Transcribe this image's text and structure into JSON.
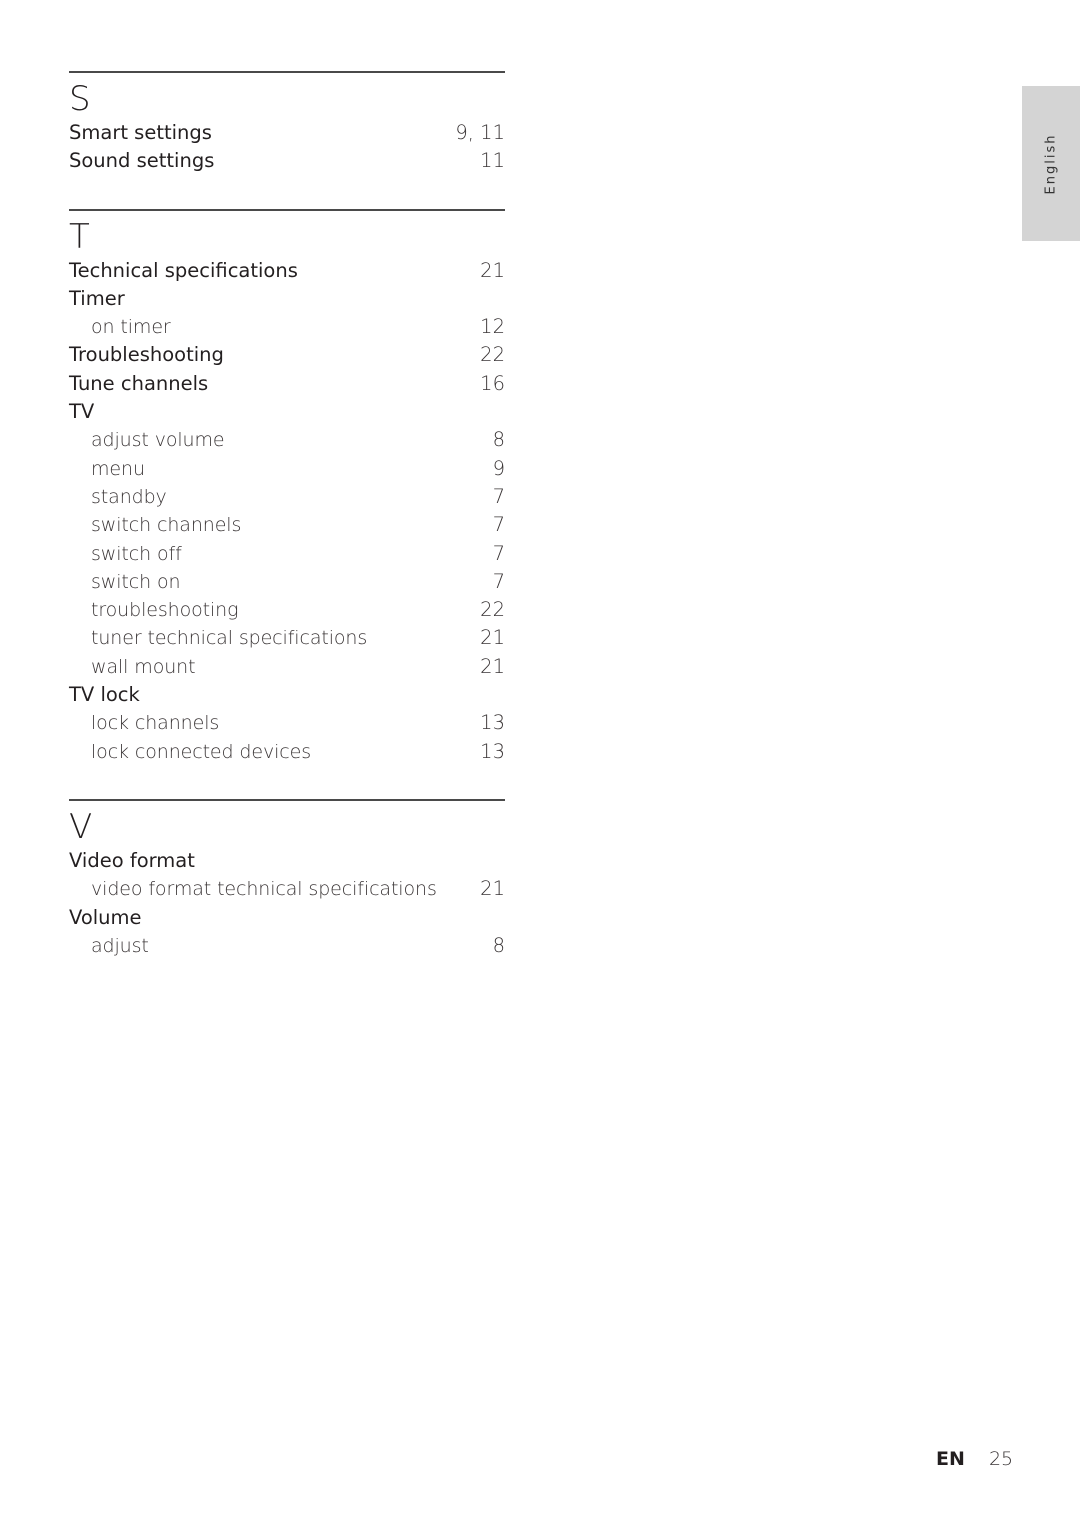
{
  "language_tab": "English",
  "footer": {
    "lang_code": "EN",
    "page_number": "25"
  },
  "sections": [
    {
      "letter": "S",
      "entries": [
        {
          "level": "main",
          "term": "Smart settings",
          "pages": "9, 11"
        },
        {
          "level": "main",
          "term": "Sound settings",
          "pages": "11"
        }
      ]
    },
    {
      "letter": "T",
      "entries": [
        {
          "level": "main",
          "term": "Technical specifications",
          "pages": "21"
        },
        {
          "level": "main",
          "term": "Timer",
          "pages": ""
        },
        {
          "level": "sub",
          "term": "on timer",
          "pages": "12"
        },
        {
          "level": "main",
          "term": "Troubleshooting",
          "pages": "22"
        },
        {
          "level": "main",
          "term": "Tune channels",
          "pages": "16"
        },
        {
          "level": "main",
          "term": "TV",
          "pages": ""
        },
        {
          "level": "sub",
          "term": "adjust volume",
          "pages": "8"
        },
        {
          "level": "sub",
          "term": "menu",
          "pages": "9"
        },
        {
          "level": "sub",
          "term": "standby",
          "pages": "7"
        },
        {
          "level": "sub",
          "term": "switch channels",
          "pages": "7"
        },
        {
          "level": "sub",
          "term": "switch off",
          "pages": "7"
        },
        {
          "level": "sub",
          "term": "switch on",
          "pages": "7"
        },
        {
          "level": "sub",
          "term": "troubleshooting",
          "pages": "22"
        },
        {
          "level": "sub",
          "term": "tuner technical specifications",
          "pages": "21"
        },
        {
          "level": "sub",
          "term": "wall mount",
          "pages": "21"
        },
        {
          "level": "main",
          "term": "TV lock",
          "pages": ""
        },
        {
          "level": "sub",
          "term": "lock channels",
          "pages": "13"
        },
        {
          "level": "sub",
          "term": "lock connected devices",
          "pages": "13"
        }
      ]
    },
    {
      "letter": "V",
      "entries": [
        {
          "level": "main",
          "term": "Video format",
          "pages": ""
        },
        {
          "level": "sub",
          "term": "video format technical specifications",
          "pages": "21"
        },
        {
          "level": "main",
          "term": "Volume",
          "pages": ""
        },
        {
          "level": "sub",
          "term": "adjust",
          "pages": "8"
        }
      ]
    }
  ]
}
